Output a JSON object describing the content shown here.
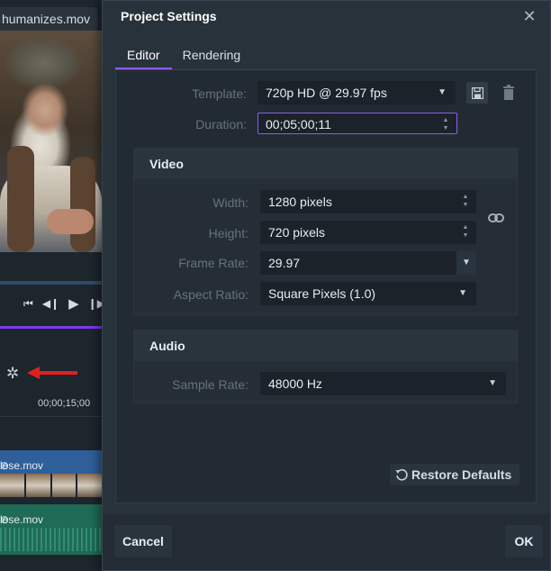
{
  "background": {
    "media_tab_title": "humanizes.mov",
    "timeline_time": "00;00;15;00",
    "video_clip_name": "lose.mov",
    "audio_clip_name": "lose.mov"
  },
  "dialog": {
    "title": "Project Settings",
    "tabs": [
      {
        "label": "Editor",
        "active": true
      },
      {
        "label": "Rendering",
        "active": false
      }
    ],
    "template": {
      "label": "Template:",
      "value": "720p HD @ 29.97 fps"
    },
    "duration": {
      "label": "Duration:",
      "value": "00;05;00;11"
    },
    "video": {
      "section_title": "Video",
      "width": {
        "label": "Width:",
        "value": "1280 pixels"
      },
      "height": {
        "label": "Height:",
        "value": "720 pixels"
      },
      "frame_rate": {
        "label": "Frame Rate:",
        "value": "29.97"
      },
      "aspect_ratio": {
        "label": "Aspect Ratio:",
        "value": "Square Pixels (1.0)"
      }
    },
    "audio": {
      "section_title": "Audio",
      "sample_rate": {
        "label": "Sample Rate:",
        "value": "48000 Hz"
      }
    },
    "restore_defaults_label": "Restore Defaults",
    "cancel_label": "Cancel",
    "ok_label": "OK"
  },
  "colors": {
    "accent": "#8b5cf6",
    "dialog_bg": "#28323b",
    "panel_bg": "#222b33",
    "field_bg": "#1b2229",
    "annotation_arrow": "#e02020"
  }
}
